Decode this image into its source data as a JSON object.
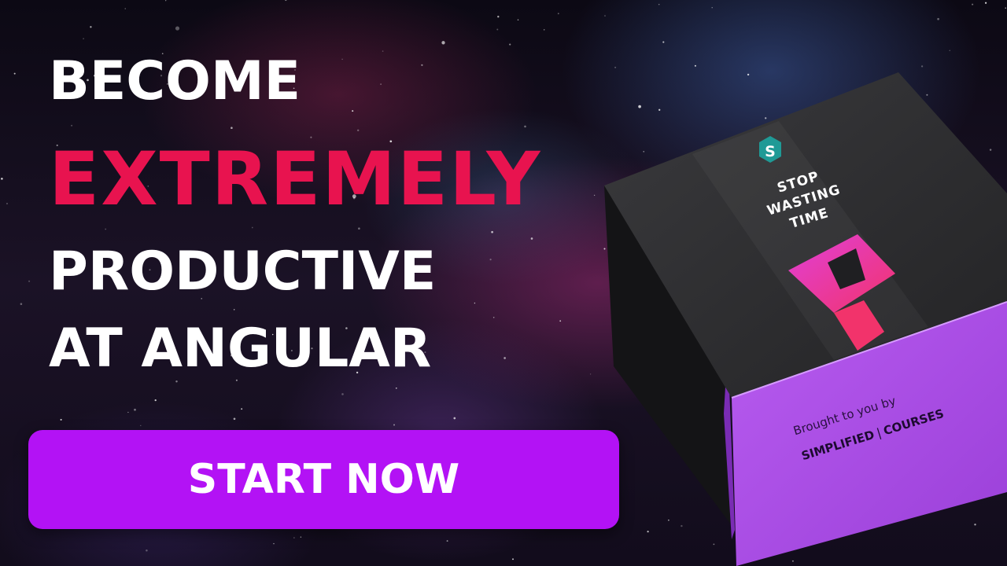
{
  "headline": {
    "line1": "BECOME",
    "line2": "EXTREMELY",
    "line3": "PRODUCTIVE",
    "line4": "AT ANGULAR"
  },
  "cta": {
    "label": "START NOW"
  },
  "product_box": {
    "badge_letter": "S",
    "tagline": [
      "STOP",
      "WASTING",
      "TIME"
    ],
    "logo_icon": "angular-logo-icon",
    "brought_text": "Brought to you by",
    "brand_left": "SIMPLIFIED",
    "brand_separator": "|",
    "brand_right": "COURSES"
  },
  "colors": {
    "headline_white": "#ffffff",
    "headline_accent": "#e8134f",
    "cta_background": "#b312f5",
    "box_top": "#2b2b2e",
    "box_band": "#a744e0",
    "badge": "#1f9a96"
  }
}
